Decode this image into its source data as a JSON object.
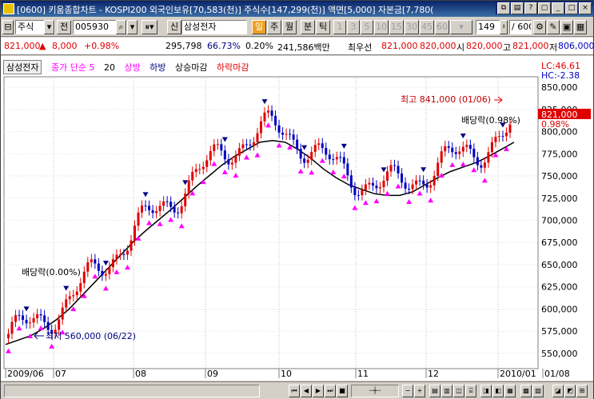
{
  "window": {
    "title": "[0600] 키움종합차트 - KOSPI200 외국인보유[70,583(천)] 주식수[147,299(천)] 액면[5,000] 자본금[7,780("
  },
  "toolbar": {
    "market": "주식",
    "jeon": "전",
    "code": "005930",
    "sin": "신",
    "stock_name": "삼성전자",
    "il": "일",
    "ju": "주",
    "wol": "월",
    "bun": "분",
    "tik": "틱",
    "periods": [
      "1",
      "3",
      "5",
      "10",
      "15",
      "30",
      "45",
      "60"
    ],
    "count": "149",
    "total": "/ 600"
  },
  "info": {
    "price": "821,000",
    "change_arrow": "▲",
    "change": "8,000",
    "change_pct": "+0.98%",
    "volume": "295,798",
    "ratio": "66.73%",
    "turnover": "0.20%",
    "amount": "241,586백만",
    "name2": "최우선",
    "ask": "821,000",
    "bid": "820,000",
    "open_label": "시",
    "open": "820,000",
    "high_label": "고",
    "high": "821,000",
    "low_label": "저",
    "low": "806,000"
  },
  "legend": {
    "name": "삼성전자",
    "ma_label": "종가 단순 5",
    "ma2": "20",
    "up": "상방",
    "down": "하방",
    "up_close": "상승마감",
    "down_close": "하락마감"
  },
  "overlay": {
    "lc": "LC:46.61",
    "hc": "HC:-2.38",
    "high_note": "최고 841,000 (01/06)",
    "low_note": "최저 560,000 (06/22)",
    "div1": "배당락(0.00%)",
    "div2": "배당락(0.98%)",
    "cur_price": "821,000",
    "cur_pct": "0.98%"
  },
  "colors": {
    "up": "#e00000",
    "down": "#0000c0",
    "ma": "#000000",
    "signal_up": "#ff00ff",
    "signal_down": "#000080"
  },
  "chart_data": {
    "type": "candlestick",
    "y_ticks": [
      "850,000",
      "825,000",
      "800,000",
      "775,000",
      "750,000",
      "725,000",
      "700,000",
      "675,000",
      "650,000",
      "625,000",
      "600,000",
      "575,000",
      "550,000"
    ],
    "x_labels": [
      "2009/06",
      "07",
      "08",
      "09",
      "10",
      "11",
      "12",
      "2010/01",
      "01/08"
    ],
    "ylim": [
      540000,
      860000
    ],
    "ma_line": [
      560000,
      565000,
      570000,
      578000,
      588000,
      600000,
      615000,
      630000,
      645000,
      660000,
      675000,
      688000,
      700000,
      712000,
      725000,
      738000,
      750000,
      762000,
      772000,
      780000,
      788000,
      790000,
      788000,
      780000,
      770000,
      758000,
      748000,
      740000,
      735000,
      730000,
      728000,
      728000,
      732000,
      740000,
      748000,
      755000,
      760000,
      765000,
      772000,
      780000,
      788000
    ]
  }
}
